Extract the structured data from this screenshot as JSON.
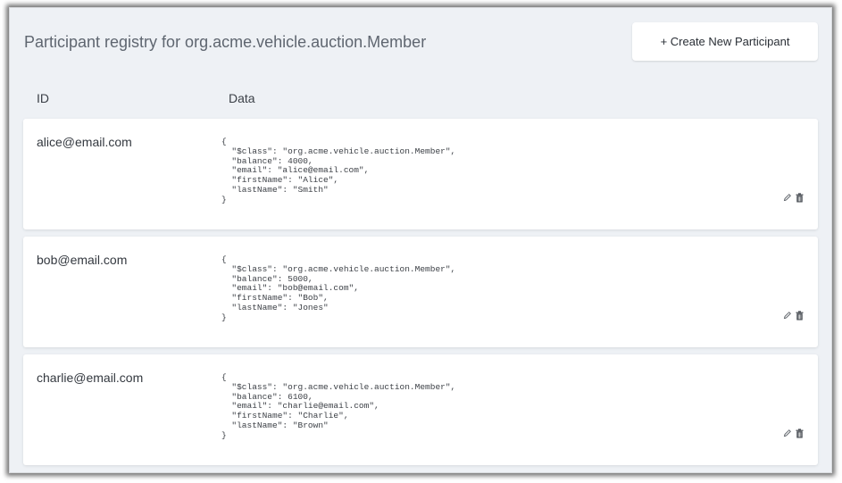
{
  "header": {
    "title": "Participant registry for org.acme.vehicle.auction.Member",
    "create_label": "+ Create New Participant"
  },
  "table": {
    "columns": {
      "id": "ID",
      "data": "Data"
    },
    "rows": [
      {
        "id": "alice@email.com",
        "data": "{\n  \"$class\": \"org.acme.vehicle.auction.Member\",\n  \"balance\": 4000,\n  \"email\": \"alice@email.com\",\n  \"firstName\": \"Alice\",\n  \"lastName\": \"Smith\"\n}"
      },
      {
        "id": "bob@email.com",
        "data": "{\n  \"$class\": \"org.acme.vehicle.auction.Member\",\n  \"balance\": 5000,\n  \"email\": \"bob@email.com\",\n  \"firstName\": \"Bob\",\n  \"lastName\": \"Jones\"\n}"
      },
      {
        "id": "charlie@email.com",
        "data": "{\n  \"$class\": \"org.acme.vehicle.auction.Member\",\n  \"balance\": 6100,\n  \"email\": \"charlie@email.com\",\n  \"firstName\": \"Charlie\",\n  \"lastName\": \"Brown\"\n}"
      }
    ]
  },
  "icons": {
    "edit": "pencil-icon",
    "delete": "trash-icon"
  },
  "colors": {
    "background": "#eef1f5",
    "card": "#ffffff",
    "text": "#33383f"
  }
}
